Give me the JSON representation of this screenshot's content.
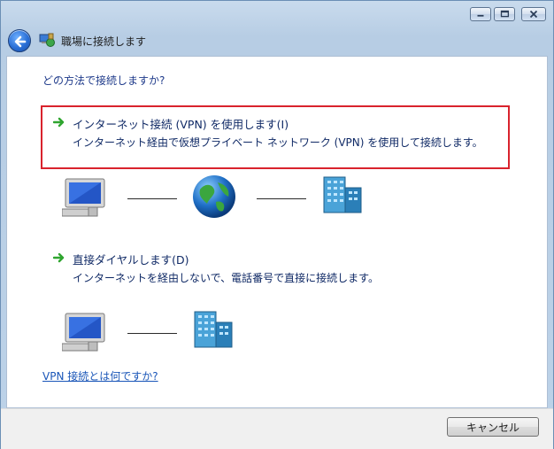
{
  "window": {
    "title": "職場に接続します",
    "controls": {
      "minimize_icon": "minimize-icon",
      "maximize_icon": "maximize-icon",
      "close_icon": "close-icon"
    }
  },
  "nav": {
    "back_icon": "back-arrow-icon"
  },
  "content": {
    "prompt": "どの方法で接続しますか?",
    "options": [
      {
        "title": "インターネット接続 (VPN) を使用します(I)",
        "description": "インターネット経由で仮想プライベート ネットワーク (VPN) を使用して接続します。",
        "selected": true
      },
      {
        "title": "直接ダイヤルします(D)",
        "description": "インターネットを経由しないで、電話番号で直接に接続します。",
        "selected": false
      }
    ],
    "help_link": "VPN 接続とは何ですか?"
  },
  "footer": {
    "cancel_label": "キャンセル"
  },
  "colors": {
    "highlight_border": "#d9232d",
    "arrow_green": "#2fa52f",
    "link_blue": "#1a56b8",
    "text_blue": "#102a66"
  }
}
